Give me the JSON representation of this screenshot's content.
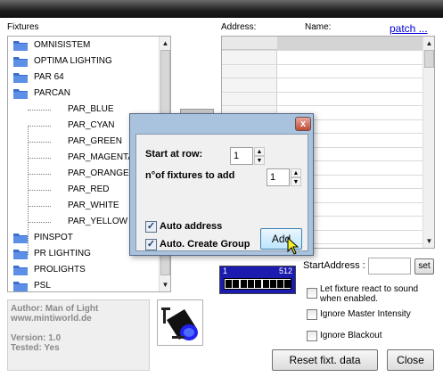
{
  "left_panel": {
    "fixtures_label": "Fixtures",
    "tree": [
      {
        "label": "OMNISISTEM",
        "kind": "folder"
      },
      {
        "label": "OPTIMA LIGHTING",
        "kind": "folder"
      },
      {
        "label": "PAR 64",
        "kind": "folder"
      },
      {
        "label": "PARCAN",
        "kind": "folder"
      },
      {
        "label": "PAR_BLUE",
        "kind": "leaf"
      },
      {
        "label": "PAR_CYAN",
        "kind": "leaf"
      },
      {
        "label": "PAR_GREEN",
        "kind": "leaf"
      },
      {
        "label": "PAR_MAGENTA",
        "kind": "leaf"
      },
      {
        "label": "PAR_ORANGE",
        "kind": "leaf"
      },
      {
        "label": "PAR_RED",
        "kind": "leaf"
      },
      {
        "label": "PAR_WHITE",
        "kind": "leaf"
      },
      {
        "label": "PAR_YELLOW",
        "kind": "leaf"
      },
      {
        "label": "PINSPOT",
        "kind": "folder"
      },
      {
        "label": "PR LIGHTING",
        "kind": "folder"
      },
      {
        "label": "PROLIGHTS",
        "kind": "folder"
      },
      {
        "label": "PSL",
        "kind": "folder"
      }
    ],
    "info": {
      "author": "Author: Man of Light",
      "website": "www.mintiworld.de",
      "version": "Version: 1.0",
      "tested": "Tested: Yes"
    }
  },
  "right_panel": {
    "address_label": "Address:",
    "name_label": "Name:",
    "patch_link": "patch ...",
    "start_address_label": "StartAddress :",
    "start_address_value": "",
    "set_button": "set",
    "dmx_min": "1",
    "dmx_max": "512",
    "options": [
      {
        "label": "Let fixture react to sound when enabled.",
        "checked": false
      },
      {
        "label": "Ignore Master Intensity",
        "checked": false
      },
      {
        "label": "Ignore Blackout",
        "checked": false
      }
    ],
    "reset_button": "Reset fixt. data",
    "close_button": "Close"
  },
  "dialog": {
    "start_row_label": "Start at row:",
    "start_row_value": "1",
    "count_label": "n°of fixtures to add",
    "count_value": "1",
    "auto_address_label": "Auto address",
    "auto_address_checked": true,
    "auto_group_label": "Auto. Create Group",
    "auto_group_checked": true,
    "add_button": "Add",
    "close_glyph": "x"
  },
  "colors": {
    "dialog_frame": "#a9c2de",
    "folder_blue": "#3a6fd0",
    "dmx_blue": "#1b1bb0",
    "link_blue": "#0000d6"
  }
}
